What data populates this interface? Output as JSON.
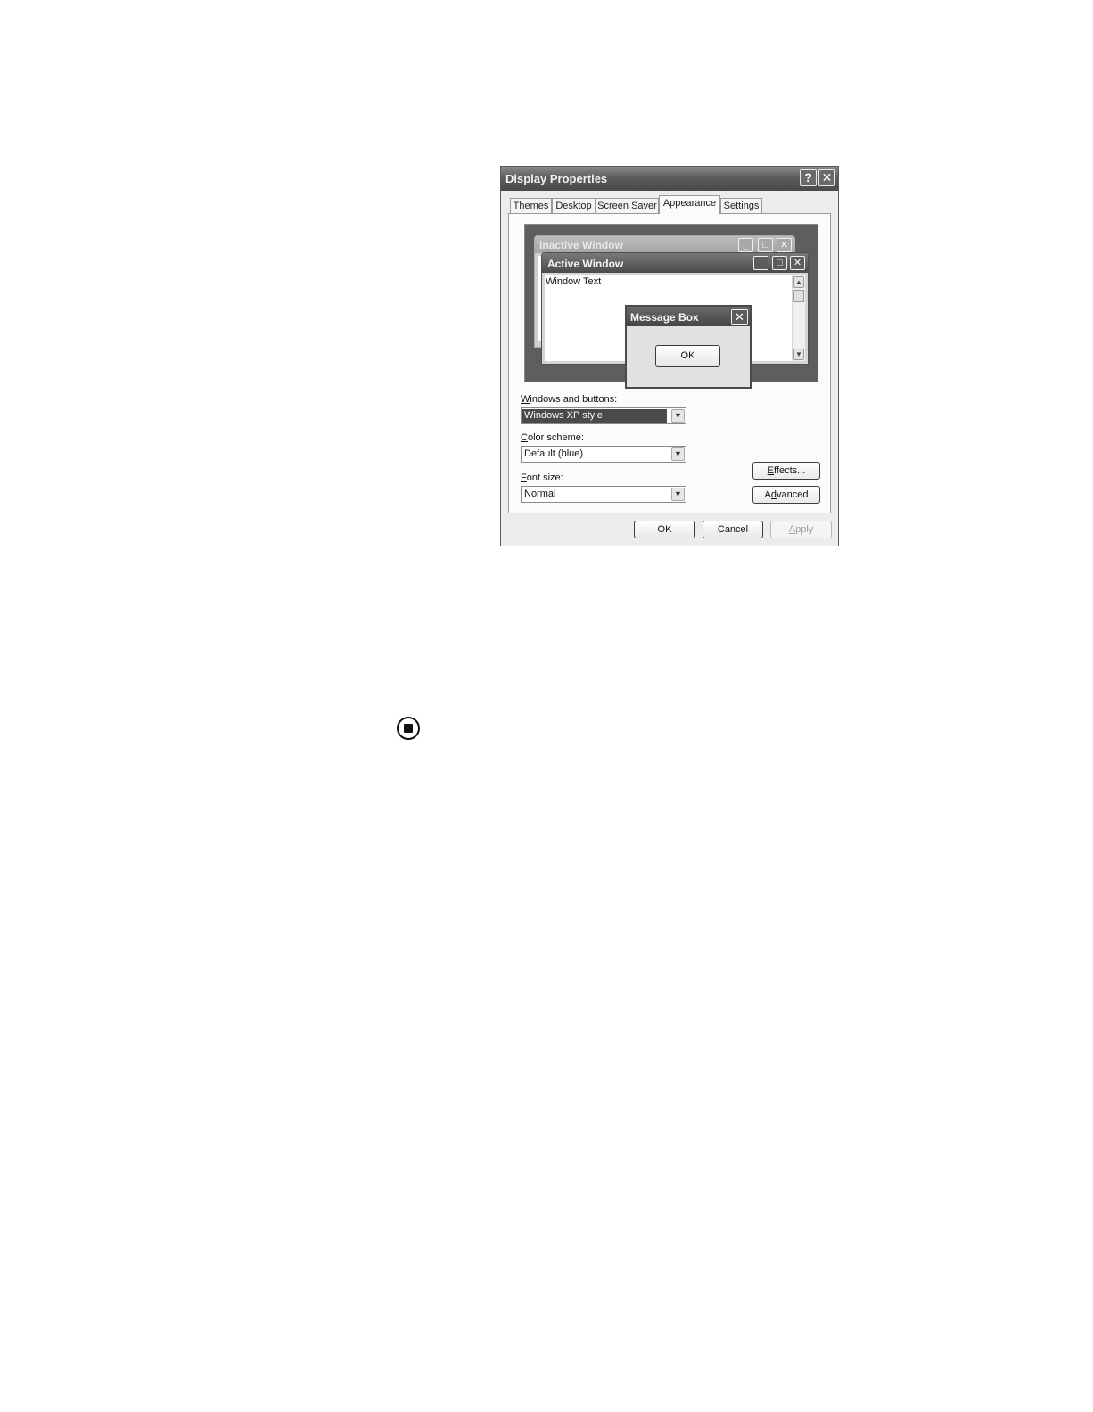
{
  "dialog": {
    "title": "Display Properties",
    "help_glyph": "?",
    "close_glyph": "✕",
    "tabs": [
      {
        "label": "Themes"
      },
      {
        "label": "Desktop"
      },
      {
        "label": "Screen Saver"
      },
      {
        "label": "Appearance"
      },
      {
        "label": "Settings"
      }
    ],
    "active_tab": "Appearance",
    "preview": {
      "inactive_title": "Inactive Window",
      "active_title": "Active Window",
      "window_text": "Window Text",
      "message_box_title": "Message Box",
      "message_ok": "OK",
      "min_glyph": "_",
      "max_glyph": "□",
      "close_glyph": "✕",
      "scroll_up": "▲",
      "scroll_down": "▼"
    },
    "windows_and_buttons": {
      "label_u": "W",
      "label_rest": "indows and buttons:",
      "value": "Windows XP style"
    },
    "color_scheme": {
      "label_u": "C",
      "label_rest": "olor scheme:",
      "value": "Default (blue)"
    },
    "font_size": {
      "label_u": "F",
      "label_rest": "ont size:",
      "value": "Normal"
    },
    "dropdown_arrow": "▼",
    "effects_button": {
      "u": "E",
      "rest": "ffects..."
    },
    "advanced_button": {
      "pre": "A",
      "u": "d",
      "rest": "vanced"
    },
    "ok_button": "OK",
    "cancel_button": "Cancel",
    "apply_button": {
      "u": "A",
      "rest": "pply"
    }
  }
}
